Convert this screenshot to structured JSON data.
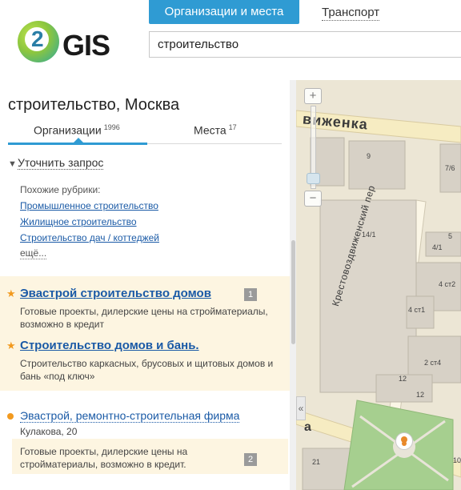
{
  "header": {
    "logo_text": "GIS",
    "logo_digit": "2",
    "tabs": [
      {
        "label": "Организации и места",
        "active": true
      },
      {
        "label": "Транспорт",
        "active": false
      }
    ],
    "search": {
      "value": "строительство"
    }
  },
  "panel": {
    "title": "строительство, Москва",
    "result_tabs": [
      {
        "label": "Организации",
        "count": "1996",
        "active": true
      },
      {
        "label": "Места",
        "count": "17",
        "active": false
      }
    ],
    "refine_label": "Уточнить запрос",
    "similar": {
      "heading": "Похожие рубрики:",
      "links": [
        "Промышленное строительство",
        "Жилищное строительство",
        "Строительство дач / коттеджей"
      ],
      "more": "ещё..."
    },
    "ads": [
      {
        "title": "Эвастрой строительство домов",
        "desc": "Готовые проекты, дилерские цены на стройматериалы, возможно в кредит",
        "badge": "1"
      },
      {
        "title": "Строительство домов и бань.",
        "desc": "Строительство каркасных, брусовых и щитовых домов и бань «под ключ»",
        "badge": ""
      }
    ],
    "results": [
      {
        "title": "Эвастрой, ремонтно-строительная фирма",
        "address": "Кулакова, 20",
        "desc": "Готовые проекты, дилерские цены на стройматериалы, возможно в кредит.",
        "badge": "2"
      }
    ]
  },
  "map": {
    "streets": [
      "вижeнка",
      "Кpестовоздвиженский пер",
      "а"
    ],
    "buildings": [
      "9",
      "7/6",
      "14/1",
      "4/1",
      "5",
      "4 ст2",
      "4 ст1",
      "2 ст4",
      "12",
      "12",
      "21",
      "10"
    ],
    "colors": {
      "road": "#f6ecc2",
      "building": "#d7d1c6",
      "park": "#a6cf8f"
    }
  },
  "colors": {
    "accent": "#2f9bd3",
    "link": "#1a5aa6",
    "ad_bg": "#fdf5e1",
    "star": "#f29a1f"
  }
}
